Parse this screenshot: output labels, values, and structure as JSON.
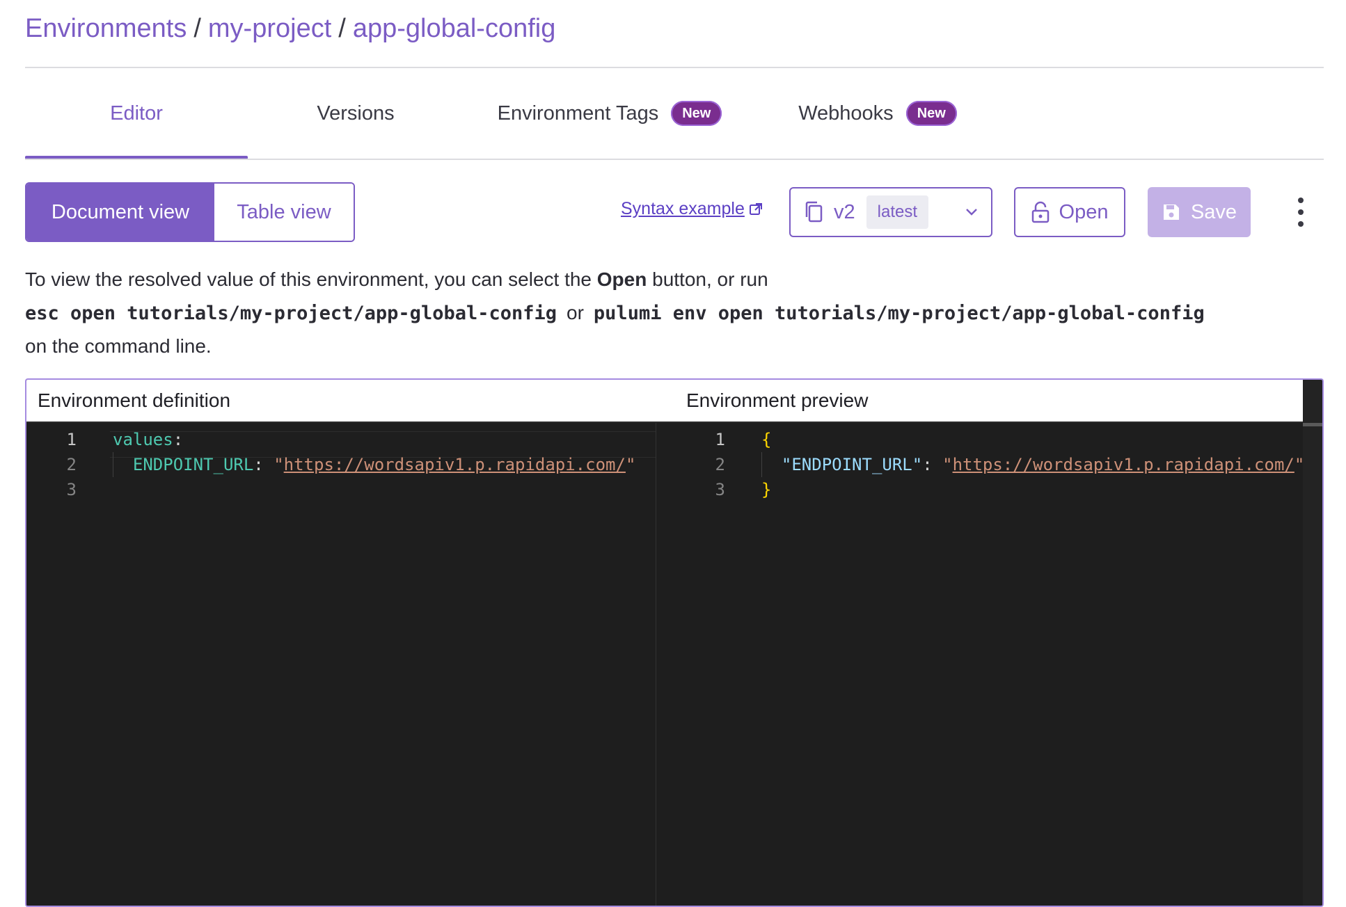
{
  "breadcrumb": {
    "root": "Environments",
    "project": "my-project",
    "env": "app-global-config",
    "separator": "/"
  },
  "tabs": [
    {
      "label": "Editor",
      "active": true
    },
    {
      "label": "Versions"
    },
    {
      "label": "Environment Tags",
      "badge": "New"
    },
    {
      "label": "Webhooks",
      "badge": "New"
    }
  ],
  "view_toggle": {
    "document": "Document view",
    "table": "Table view",
    "selected": "Document view"
  },
  "syntax_link": "Syntax example",
  "version": {
    "number": "v2",
    "tag": "latest"
  },
  "buttons": {
    "open": "Open",
    "save": "Save"
  },
  "info": {
    "line1_pre": "To view the resolved value of this environment, you can select the",
    "line1_bold": "Open",
    "line1_post": "button, or run",
    "cmd1": "esc open tutorials/my-project/app-global-config",
    "or": "or",
    "cmd2": "pulumi env open tutorials/my-project/app-global-config",
    "line3": "on the command line."
  },
  "editor": {
    "definition_title": "Environment definition",
    "preview_title": "Environment preview",
    "definition_lines": [
      "1",
      "2",
      "3"
    ],
    "definition": {
      "key_values": "values",
      "key_endpoint": "ENDPOINT_URL",
      "value_endpoint": "https://wordsapiv1.p.rapidapi.com/"
    },
    "preview_lines": [
      "1",
      "2",
      "3"
    ],
    "preview": {
      "open_brace": "{",
      "key_endpoint": "\"ENDPOINT_URL\"",
      "value_endpoint": "https://wordsapiv1.p.rapidapi.com/",
      "close_brace": "}"
    }
  },
  "colors": {
    "accent": "#7b5cc4",
    "badge": "#7a2d8f",
    "editor_bg": "#1e1e1e",
    "save_disabled": "#c3b1e6"
  }
}
